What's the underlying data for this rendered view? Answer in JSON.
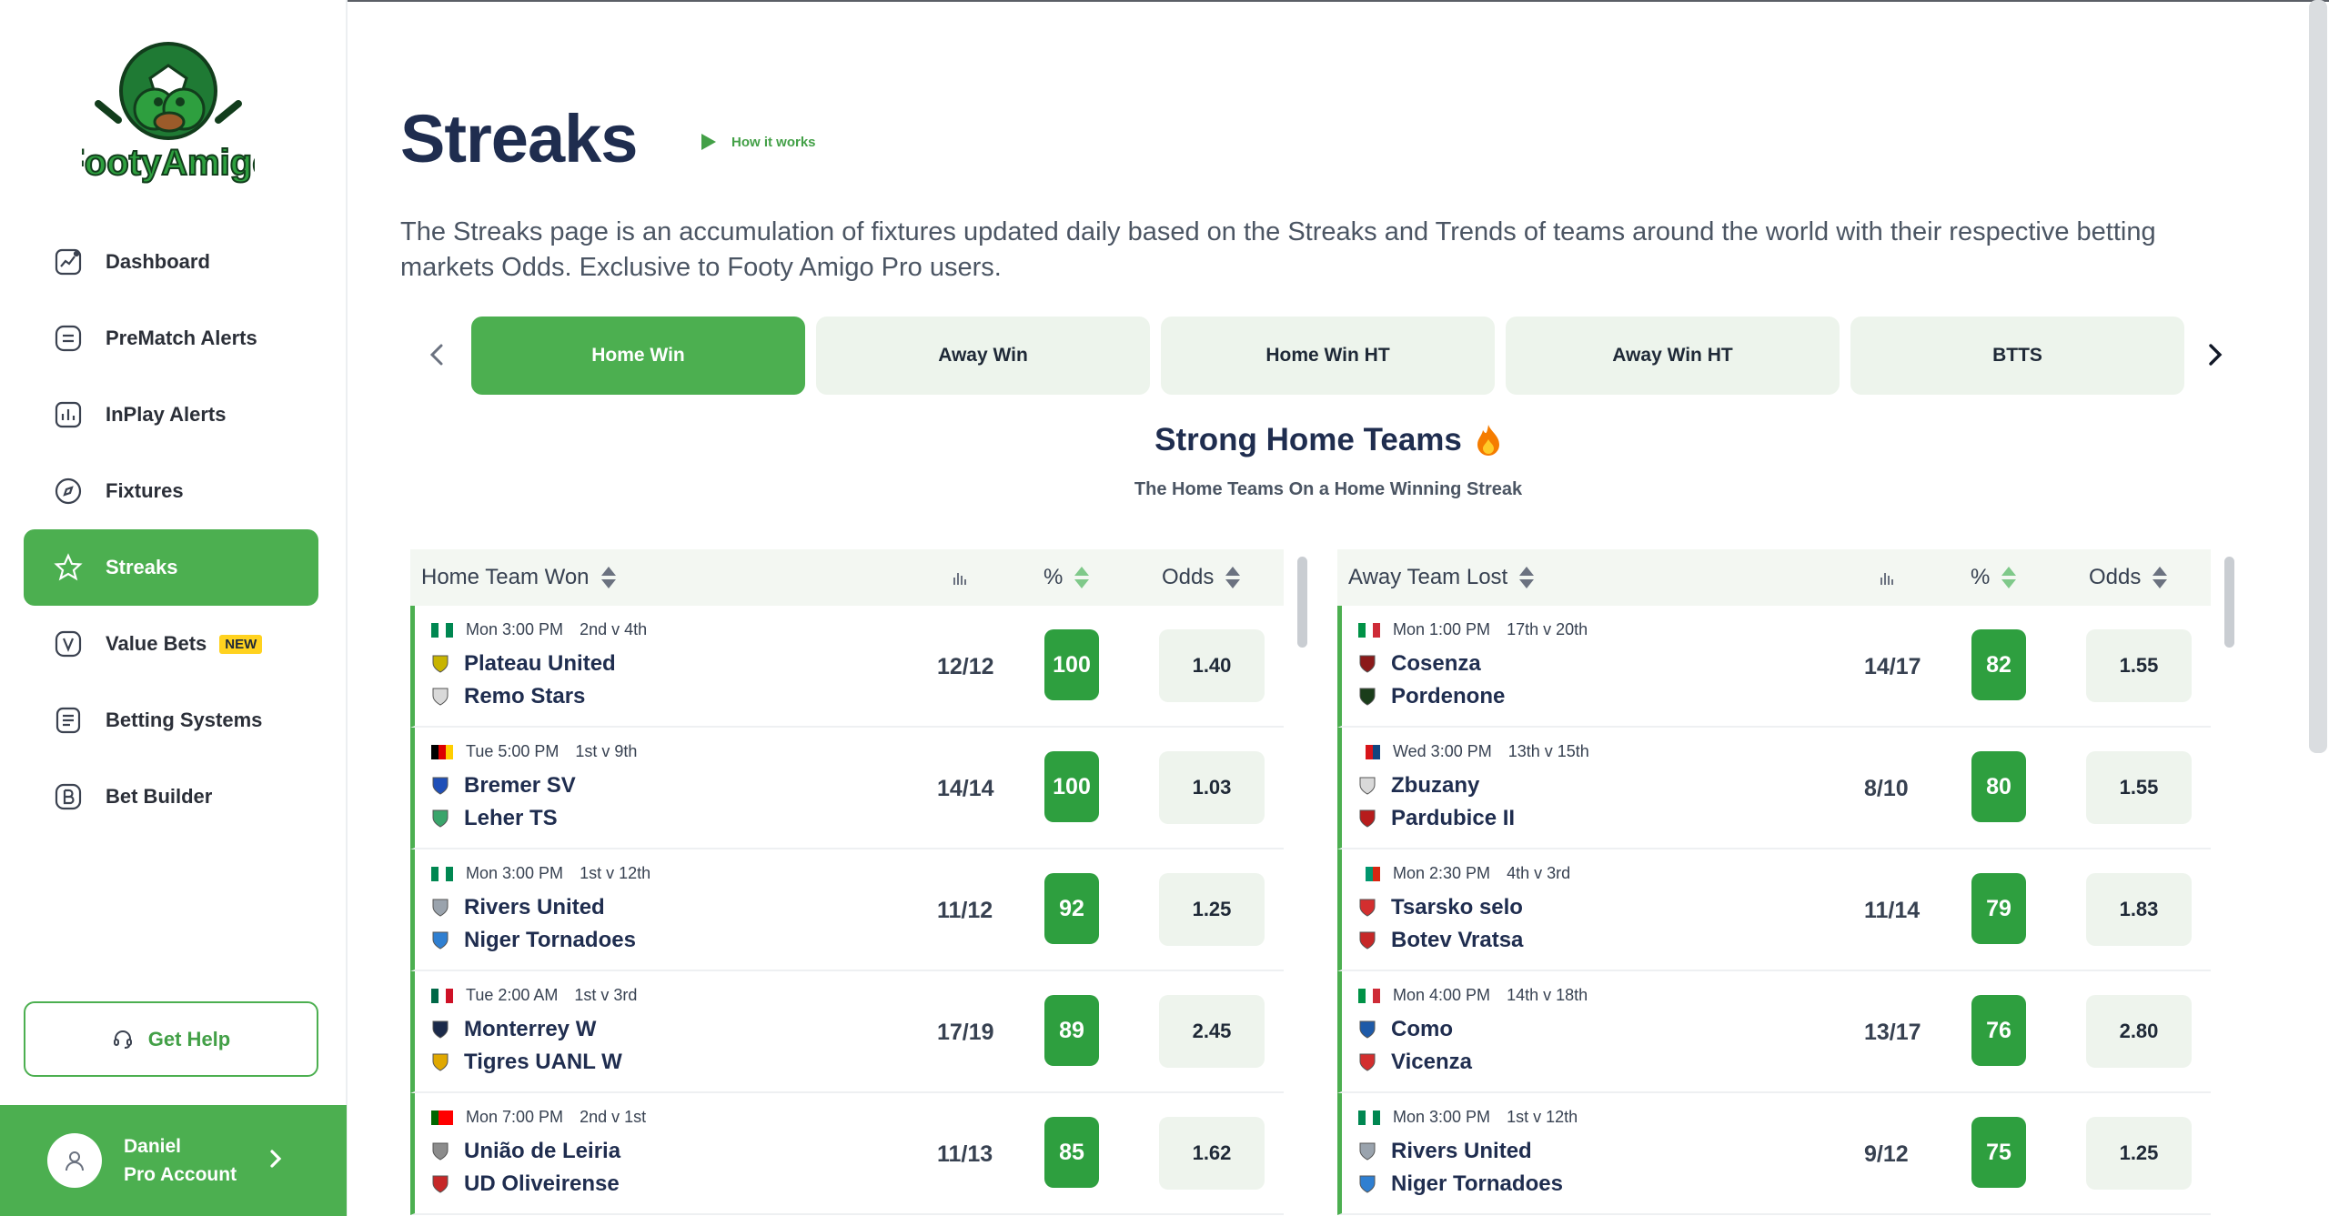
{
  "brand": {
    "logo_text": "FootyAmigo",
    "accent": "#4caf50"
  },
  "sidebar": {
    "items": [
      {
        "label": "Dashboard",
        "icon": "chart-line-icon",
        "active": false
      },
      {
        "label": "PreMatch Alerts",
        "icon": "list-icon",
        "active": false
      },
      {
        "label": "InPlay Alerts",
        "icon": "bar-chart-icon",
        "active": false
      },
      {
        "label": "Fixtures",
        "icon": "compass-icon",
        "active": false
      },
      {
        "label": "Streaks",
        "icon": "star-icon",
        "active": true
      },
      {
        "label": "Value Bets",
        "icon": "v-icon",
        "active": false,
        "badge": "NEW"
      },
      {
        "label": "Betting Systems",
        "icon": "document-icon",
        "active": false
      },
      {
        "label": "Bet Builder",
        "icon": "b-icon",
        "active": false
      }
    ],
    "help_label": "Get Help",
    "account": {
      "name": "Daniel",
      "plan": "Pro Account"
    }
  },
  "header": {
    "title": "Streaks",
    "how_it_works": "How it works",
    "intro": "The Streaks page is an accumulation of fixtures updated daily based on the Streaks and Trends of teams around the world with their respective betting markets Odds. Exclusive to Footy Amigo Pro users."
  },
  "tabs": [
    {
      "label": "Home Win",
      "active": true
    },
    {
      "label": "Away Win",
      "active": false
    },
    {
      "label": "Home Win HT",
      "active": false
    },
    {
      "label": "Away Win HT",
      "active": false
    },
    {
      "label": "BTTS",
      "active": false
    }
  ],
  "section": {
    "title": "Strong Home Teams",
    "subtitle": "The Home Teams On a Home Winning Streak"
  },
  "left_table": {
    "header": {
      "title": "Home Team Won",
      "pct": "%",
      "odds": "Odds"
    },
    "rows": [
      {
        "time": "Mon 3:00 PM",
        "pos": "2nd v 4th",
        "flag": [
          "#008751",
          "#ffffff",
          "#008751"
        ],
        "home": "Plateau United",
        "away": "Remo Stars",
        "ratio": "12/12",
        "pct": "100",
        "odds": "1.40",
        "home_crest": "#c8b400",
        "away_crest": "#d9d9d9"
      },
      {
        "time": "Tue 5:00 PM",
        "pos": "1st v 9th",
        "flag": [
          "#000000",
          "#dd0000",
          "#ffce00"
        ],
        "home": "Bremer SV",
        "away": "Leher TS",
        "ratio": "14/14",
        "pct": "100",
        "odds": "1.03",
        "home_crest": "#1f4fb8",
        "away_crest": "#3aa56b"
      },
      {
        "time": "Mon 3:00 PM",
        "pos": "1st v 12th",
        "flag": [
          "#008751",
          "#ffffff",
          "#008751"
        ],
        "home": "Rivers United",
        "away": "Niger Tornadoes",
        "ratio": "11/12",
        "pct": "92",
        "odds": "1.25",
        "home_crest": "#9aa3ad",
        "away_crest": "#2f7fd1"
      },
      {
        "time": "Tue 2:00 AM",
        "pos": "1st v 3rd",
        "flag": [
          "#006847",
          "#ffffff",
          "#ce1126"
        ],
        "home": "Monterrey W",
        "away": "Tigres UANL W",
        "ratio": "17/19",
        "pct": "89",
        "odds": "2.45",
        "home_crest": "#1b2a4a",
        "away_crest": "#e0a800"
      },
      {
        "time": "Mon 7:00 PM",
        "pos": "2nd v 1st",
        "flag": [
          "#006600",
          "#ff0000",
          "#ff0000"
        ],
        "home": "União de Leiria",
        "away": "UD Oliveirense",
        "ratio": "11/13",
        "pct": "85",
        "odds": "1.62",
        "home_crest": "#8c8c8c",
        "away_crest": "#c62828"
      }
    ]
  },
  "right_table": {
    "header": {
      "title": "Away Team Lost",
      "pct": "%",
      "odds": "Odds"
    },
    "rows": [
      {
        "time": "Mon 1:00 PM",
        "pos": "17th v 20th",
        "flag": [
          "#009246",
          "#ffffff",
          "#ce2b37"
        ],
        "home": "Cosenza",
        "away": "Pordenone",
        "ratio": "14/17",
        "pct": "82",
        "odds": "1.55",
        "home_crest": "#8b1a1a",
        "away_crest": "#1a3d1a"
      },
      {
        "time": "Wed 3:00 PM",
        "pos": "13th v 15th",
        "flag": [
          "#ffffff",
          "#d7141a",
          "#11457e"
        ],
        "home": "Zbuzany",
        "away": "Pardubice II",
        "ratio": "8/10",
        "pct": "80",
        "odds": "1.55",
        "home_crest": "#d9d9d9",
        "away_crest": "#b71c1c"
      },
      {
        "time": "Mon 2:30 PM",
        "pos": "4th v 3rd",
        "flag": [
          "#ffffff",
          "#00966e",
          "#d62612"
        ],
        "home": "Tsarsko selo",
        "away": "Botev Vratsa",
        "ratio": "11/14",
        "pct": "79",
        "odds": "1.83",
        "home_crest": "#d32f2f",
        "away_crest": "#c62828"
      },
      {
        "time": "Mon 4:00 PM",
        "pos": "14th v 18th",
        "flag": [
          "#009246",
          "#ffffff",
          "#ce2b37"
        ],
        "home": "Como",
        "away": "Vicenza",
        "ratio": "13/17",
        "pct": "76",
        "odds": "2.80",
        "home_crest": "#1e5aa8",
        "away_crest": "#d32f2f"
      },
      {
        "time": "Mon 3:00 PM",
        "pos": "1st v 12th",
        "flag": [
          "#008751",
          "#ffffff",
          "#008751"
        ],
        "home": "Rivers United",
        "away": "Niger Tornadoes",
        "ratio": "9/12",
        "pct": "75",
        "odds": "1.25",
        "home_crest": "#9aa3ad",
        "away_crest": "#2f7fd1"
      }
    ]
  }
}
